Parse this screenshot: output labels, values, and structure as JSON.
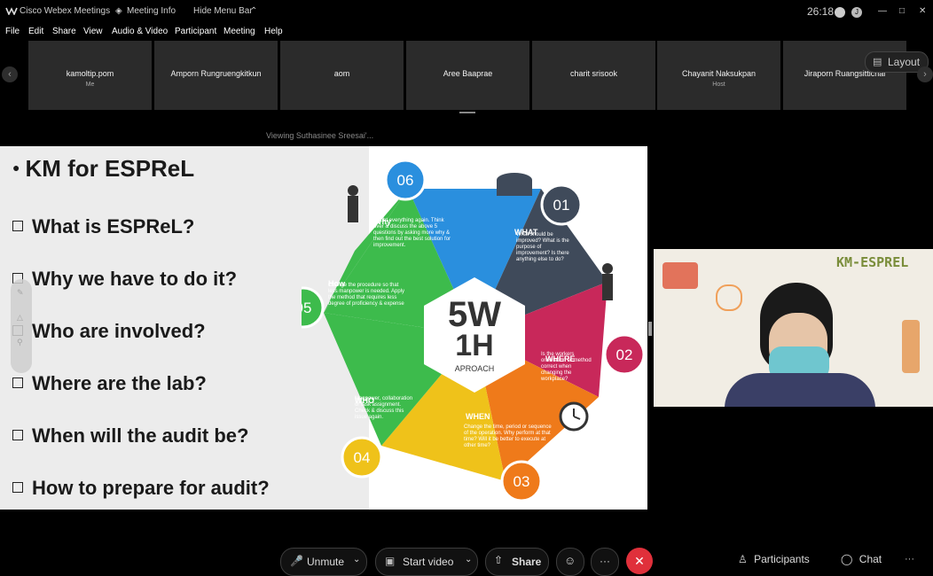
{
  "titlebar": {
    "app": "Cisco Webex Meetings",
    "meeting_info": "Meeting Info",
    "hide_menu": "Hide Menu Bar",
    "timer": "26:18",
    "layout": "Layout"
  },
  "menu": [
    "File",
    "Edit",
    "Share",
    "View",
    "Audio & Video",
    "Participant",
    "Meeting",
    "Help"
  ],
  "participants": [
    {
      "name": "kamoltip.pom",
      "sub": "Me"
    },
    {
      "name": "Amporn Rungruengkitkun",
      "sub": ""
    },
    {
      "name": "aom",
      "sub": ""
    },
    {
      "name": "Aree Baaprae",
      "sub": ""
    },
    {
      "name": "charit srisook",
      "sub": ""
    },
    {
      "name": "Chayanit Naksukpan",
      "sub": "Host"
    },
    {
      "name": "Jiraporn Ruangsittichai",
      "sub": ""
    }
  ],
  "viewing": "Viewing Suthasinee Sreesai'...",
  "slide": {
    "title": "KM for ESPReL",
    "questions": [
      "What is ESPReL?",
      "Why we have to do it?",
      "Who are involved?",
      "Where are the lab?",
      "When will the audit be?",
      "How to prepare for audit?"
    ],
    "center_line1": "5W",
    "center_line2": "1H",
    "center_line3": "APROACH",
    "segments": [
      {
        "num": "01",
        "head": "WHAT",
        "text": "What should be improved? What is the purpose of improvement? Is there anything else to do?",
        "color": "#3f4a5a"
      },
      {
        "num": "02",
        "head": "WHERE",
        "text": "Is the workers orientation or method correct when changing the workplace?",
        "color": "#c8285a"
      },
      {
        "num": "03",
        "head": "WHEN",
        "text": "Change the time, period or sequence of the operation. Why perform at that time? Will it be better to execute at other time?",
        "color": "#ef7a1a"
      },
      {
        "num": "04",
        "head": "WHO",
        "text": "Manpower, collaboration or task assignment. Check & discuss this issue again.",
        "color": "#efc21a"
      },
      {
        "num": "05",
        "head": "How",
        "text": "Change the procedure so that less manpower is needed. Apply the method that requires less degree of proficiency & expense",
        "color": "#3dbb4c"
      },
      {
        "num": "06",
        "head": "Why",
        "text": "Doubt everything again. Think over & discuss the above 5 questions by asking more why & then find out the best solution for improvement.",
        "color": "#2a8fde"
      }
    ]
  },
  "video": {
    "banner": "KM-ESPREL"
  },
  "controls": {
    "unmute": "Unmute",
    "start_video": "Start video",
    "share": "Share",
    "participants": "Participants",
    "chat": "Chat",
    "more": "···"
  }
}
